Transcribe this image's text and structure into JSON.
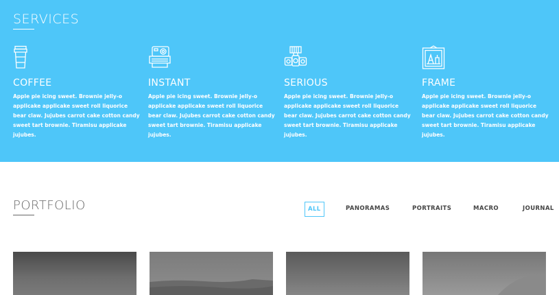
{
  "services": {
    "title": "SERVICES",
    "items": [
      {
        "name": "COFFEE",
        "icon": "coffee-cup-icon",
        "description": "Apple pie icing sweet. Brownie jelly-o applicake applicake sweet roll liquorice bear claw. Jujubes carrot cake cotton candy sweet tart brownie. Tiramisu applicake jujubes."
      },
      {
        "name": "INSTANT",
        "icon": "instant-camera-icon",
        "description": "Apple pie icing sweet. Brownie jelly-o applicake applicake sweet roll liquorice bear claw. Jujubes carrot cake cotton candy sweet tart brownie. Tiramisu applicake jujubes."
      },
      {
        "name": "SERIOUS",
        "icon": "dslr-camera-icon",
        "description": "Apple pie icing sweet. Brownie jelly-o applicake applicake sweet roll liquorice bear claw. Jujubes carrot cake cotton candy sweet tart brownie. Tiramisu applicake jujubes."
      },
      {
        "name": "FRAME",
        "icon": "picture-frame-icon",
        "description": "Apple pie icing sweet. Brownie jelly-o applicake applicake sweet roll liquorice bear claw. Jujubes carrot cake cotton candy sweet tart brownie. Tiramisu applicake jujubes."
      }
    ]
  },
  "portfolio": {
    "title": "PORTFOLIO",
    "filters": [
      "ALL",
      "PANORAMAS",
      "PORTRAITS",
      "MACRO",
      "JOURNAL"
    ],
    "active_filter": "ALL"
  },
  "colors": {
    "accent": "#4ec6f9",
    "text_dark": "#444444",
    "heading_gray": "#666666"
  }
}
